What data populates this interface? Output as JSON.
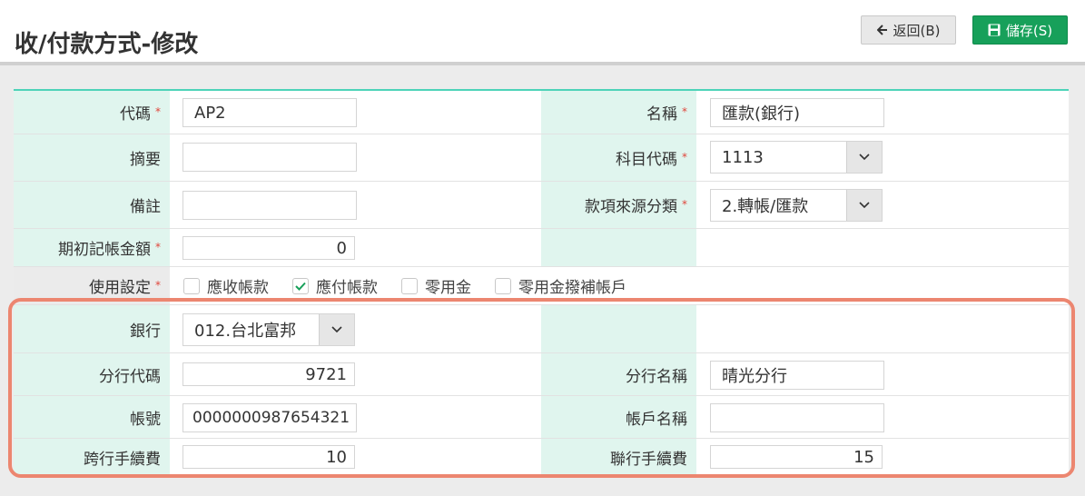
{
  "header": {
    "title": "收/付款方式-修改",
    "back_label": "返回(B)",
    "save_label": "儲存(S)"
  },
  "colors": {
    "accent": "#17a05a",
    "label_bg": "#e0f5ee",
    "highlight": "#ec8670",
    "top_border": "#4dd3b8",
    "required": "#e0463b"
  },
  "form": {
    "code_label": "代碼",
    "code_value": "AP2",
    "name_label": "名稱",
    "name_value": "匯款(銀行)",
    "summary_label": "摘要",
    "summary_value": "",
    "subject_label": "科目代碼",
    "subject_value": "1113",
    "note_label": "備註",
    "note_value": "",
    "source_label": "款項來源分類",
    "source_value": "2.轉帳/匯款",
    "opening_label": "期初記帳金額",
    "opening_value": "0",
    "usage_label": "使用設定",
    "usage_options": [
      {
        "label": "應收帳款",
        "checked": false
      },
      {
        "label": "應付帳款",
        "checked": true
      },
      {
        "label": "零用金",
        "checked": false
      },
      {
        "label": "零用金撥補帳戶",
        "checked": false
      }
    ],
    "bank_label": "銀行",
    "bank_value": "012.台北富邦",
    "branch_code_label": "分行代碼",
    "branch_code_value": "9721",
    "branch_name_label": "分行名稱",
    "branch_name_value": "晴光分行",
    "account_label": "帳號",
    "account_value": "0000000987654321",
    "account_name_label": "帳戶名稱",
    "account_name_value": "",
    "cross_fee_label": "跨行手續費",
    "cross_fee_value": "10",
    "union_fee_label": "聯行手續費",
    "union_fee_value": "15",
    "required_mark": "*"
  }
}
